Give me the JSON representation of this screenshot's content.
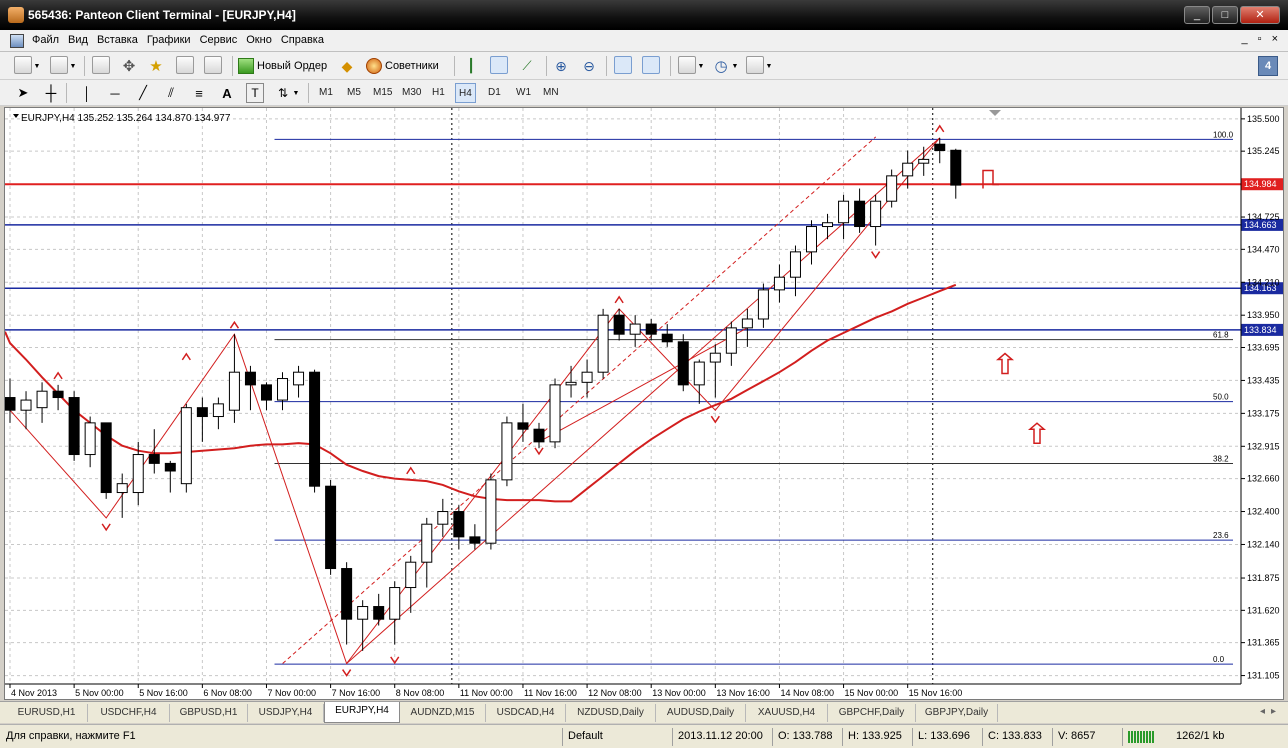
{
  "window": {
    "title": "565436: Panteon Client Terminal - [EURJPY,H4]",
    "buttons": [
      "_",
      "□",
      "✕"
    ]
  },
  "menu": {
    "items": [
      "Файл",
      "Вид",
      "Вставка",
      "Графики",
      "Сервис",
      "Окно",
      "Справка"
    ],
    "mdi_buttons": [
      "_",
      "▫",
      "×"
    ]
  },
  "toolbar": {
    "new_order_label": "Новый Ордер",
    "advisors_label": "Советники"
  },
  "timeframes": [
    "M1",
    "M5",
    "M15",
    "M30",
    "H1",
    "H4",
    "D1",
    "W1",
    "MN"
  ],
  "active_timeframe": "H4",
  "chart": {
    "header": "EURJPY,H4  135.252 135.264 134.870 134.977",
    "price_labels": [
      "135.500",
      "135.245",
      "134.725",
      "134.470",
      "134.210",
      "133.950",
      "133.695",
      "133.435",
      "133.175",
      "132.915",
      "132.660",
      "132.400",
      "132.140",
      "131.875",
      "131.620",
      "131.365",
      "131.105"
    ],
    "highlight_labels": [
      {
        "text": "134.984",
        "price": 134.984,
        "color": "#e02020"
      },
      {
        "text": "134.663",
        "price": 134.663,
        "color": "#1a2aa0"
      },
      {
        "text": "134.163",
        "price": 134.163,
        "color": "#1a2aa0"
      },
      {
        "text": "133.834",
        "price": 133.834,
        "color": "#1a2aa0"
      }
    ],
    "fib_levels": [
      {
        "label": "100.0",
        "price": 135.338
      },
      {
        "label": "61.8",
        "price": 133.757
      },
      {
        "label": "50.0",
        "price": 133.268
      },
      {
        "label": "38.2",
        "price": 132.779
      },
      {
        "label": "23.6",
        "price": 132.174
      },
      {
        "label": "0.0",
        "price": 131.195
      }
    ],
    "time_labels": [
      "4 Nov 2013",
      "5 Nov 00:00",
      "5 Nov 16:00",
      "6 Nov 08:00",
      "7 Nov 00:00",
      "7 Nov 16:00",
      "8 Nov 08:00",
      "11 Nov 00:00",
      "11 Nov 16:00",
      "12 Nov 08:00",
      "13 Nov 00:00",
      "13 Nov 16:00",
      "14 Nov 08:00",
      "15 Nov 00:00",
      "15 Nov 16:00"
    ]
  },
  "chart_data": {
    "type": "candlestick",
    "symbol": "EURJPY",
    "timeframe": "H4",
    "ylim": [
      131.07,
      135.57
    ],
    "grid": true,
    "candles": [
      {
        "o": 133.3,
        "h": 133.45,
        "l": 133.1,
        "c": 133.2
      },
      {
        "o": 133.2,
        "h": 133.35,
        "l": 133.05,
        "c": 133.28
      },
      {
        "o": 133.22,
        "h": 133.42,
        "l": 133.1,
        "c": 133.35
      },
      {
        "o": 133.35,
        "h": 133.4,
        "l": 133.2,
        "c": 133.3
      },
      {
        "o": 133.3,
        "h": 133.35,
        "l": 132.8,
        "c": 132.85
      },
      {
        "o": 132.85,
        "h": 133.15,
        "l": 132.75,
        "c": 133.1
      },
      {
        "o": 133.1,
        "h": 133.1,
        "l": 132.5,
        "c": 132.55
      },
      {
        "o": 132.55,
        "h": 132.7,
        "l": 132.35,
        "c": 132.62
      },
      {
        "o": 132.55,
        "h": 132.95,
        "l": 132.45,
        "c": 132.85
      },
      {
        "o": 132.85,
        "h": 133.05,
        "l": 132.7,
        "c": 132.78
      },
      {
        "o": 132.78,
        "h": 132.8,
        "l": 132.55,
        "c": 132.72
      },
      {
        "o": 132.62,
        "h": 133.25,
        "l": 132.55,
        "c": 133.22
      },
      {
        "o": 133.22,
        "h": 133.3,
        "l": 132.95,
        "c": 133.15
      },
      {
        "o": 133.15,
        "h": 133.3,
        "l": 133.05,
        "c": 133.25
      },
      {
        "o": 133.2,
        "h": 133.8,
        "l": 133.1,
        "c": 133.5
      },
      {
        "o": 133.5,
        "h": 133.55,
        "l": 133.2,
        "c": 133.4
      },
      {
        "o": 133.4,
        "h": 133.42,
        "l": 133.2,
        "c": 133.28
      },
      {
        "o": 133.28,
        "h": 133.5,
        "l": 133.2,
        "c": 133.45
      },
      {
        "o": 133.4,
        "h": 133.55,
        "l": 133.3,
        "c": 133.5
      },
      {
        "o": 133.5,
        "h": 133.52,
        "l": 132.55,
        "c": 132.6
      },
      {
        "o": 132.6,
        "h": 132.65,
        "l": 131.9,
        "c": 131.95
      },
      {
        "o": 131.95,
        "h": 132.0,
        "l": 131.35,
        "c": 131.55
      },
      {
        "o": 131.55,
        "h": 131.7,
        "l": 131.3,
        "c": 131.65
      },
      {
        "o": 131.65,
        "h": 131.75,
        "l": 131.5,
        "c": 131.55
      },
      {
        "o": 131.55,
        "h": 131.85,
        "l": 131.35,
        "c": 131.8
      },
      {
        "o": 131.8,
        "h": 132.05,
        "l": 131.6,
        "c": 132.0
      },
      {
        "o": 132.0,
        "h": 132.35,
        "l": 131.8,
        "c": 132.3
      },
      {
        "o": 132.3,
        "h": 132.5,
        "l": 132.2,
        "c": 132.4
      },
      {
        "o": 132.4,
        "h": 132.45,
        "l": 132.1,
        "c": 132.2
      },
      {
        "o": 132.2,
        "h": 132.3,
        "l": 132.1,
        "c": 132.15
      },
      {
        "o": 132.15,
        "h": 132.7,
        "l": 132.1,
        "c": 132.65
      },
      {
        "o": 132.65,
        "h": 133.15,
        "l": 132.6,
        "c": 133.1
      },
      {
        "o": 133.1,
        "h": 133.25,
        "l": 132.95,
        "c": 133.05
      },
      {
        "o": 133.05,
        "h": 133.1,
        "l": 132.9,
        "c": 132.95
      },
      {
        "o": 132.95,
        "h": 133.45,
        "l": 132.9,
        "c": 133.4
      },
      {
        "o": 133.4,
        "h": 133.55,
        "l": 133.3,
        "c": 133.42
      },
      {
        "o": 133.42,
        "h": 133.6,
        "l": 133.3,
        "c": 133.5
      },
      {
        "o": 133.5,
        "h": 134.0,
        "l": 133.45,
        "c": 133.95
      },
      {
        "o": 133.95,
        "h": 134.0,
        "l": 133.75,
        "c": 133.8
      },
      {
        "o": 133.8,
        "h": 133.95,
        "l": 133.7,
        "c": 133.88
      },
      {
        "o": 133.88,
        "h": 133.92,
        "l": 133.75,
        "c": 133.8
      },
      {
        "o": 133.8,
        "h": 133.88,
        "l": 133.7,
        "c": 133.74
      },
      {
        "o": 133.74,
        "h": 133.8,
        "l": 133.35,
        "c": 133.4
      },
      {
        "o": 133.4,
        "h": 133.6,
        "l": 133.25,
        "c": 133.58
      },
      {
        "o": 133.58,
        "h": 133.72,
        "l": 133.3,
        "c": 133.65
      },
      {
        "o": 133.65,
        "h": 133.9,
        "l": 133.55,
        "c": 133.85
      },
      {
        "o": 133.85,
        "h": 134.0,
        "l": 133.7,
        "c": 133.92
      },
      {
        "o": 133.92,
        "h": 134.2,
        "l": 133.85,
        "c": 134.15
      },
      {
        "o": 134.15,
        "h": 134.35,
        "l": 134.05,
        "c": 134.25
      },
      {
        "o": 134.25,
        "h": 134.5,
        "l": 134.1,
        "c": 134.45
      },
      {
        "o": 134.45,
        "h": 134.7,
        "l": 134.35,
        "c": 134.65
      },
      {
        "o": 134.65,
        "h": 134.75,
        "l": 134.55,
        "c": 134.68
      },
      {
        "o": 134.68,
        "h": 134.9,
        "l": 134.55,
        "c": 134.85
      },
      {
        "o": 134.85,
        "h": 134.95,
        "l": 134.6,
        "c": 134.65
      },
      {
        "o": 134.65,
        "h": 134.9,
        "l": 134.5,
        "c": 134.85
      },
      {
        "o": 134.85,
        "h": 135.1,
        "l": 134.8,
        "c": 135.05
      },
      {
        "o": 135.05,
        "h": 135.25,
        "l": 134.95,
        "c": 135.15
      },
      {
        "o": 135.15,
        "h": 135.28,
        "l": 135.05,
        "c": 135.18
      },
      {
        "o": 135.3,
        "h": 135.35,
        "l": 135.15,
        "c": 135.25
      },
      {
        "o": 135.252,
        "h": 135.264,
        "l": 134.87,
        "c": 134.977
      }
    ],
    "ma": [
      133.73,
      133.6,
      133.46,
      133.33,
      133.2,
      133.1,
      133.0,
      132.92,
      132.88,
      132.86,
      132.86,
      132.87,
      132.88,
      132.89,
      132.9,
      132.92,
      132.93,
      132.93,
      132.94,
      132.93,
      132.86,
      132.77,
      132.72,
      132.68,
      132.66,
      132.65,
      132.64,
      132.61,
      132.56,
      132.52,
      132.5,
      132.49,
      132.49,
      132.49,
      132.48,
      132.48,
      132.58,
      132.68,
      132.78,
      132.88,
      132.97,
      133.05,
      133.13,
      133.19,
      133.24,
      133.29,
      133.36,
      133.43,
      133.5,
      133.58,
      133.67,
      133.75,
      133.81,
      133.87,
      133.93,
      133.98,
      134.04,
      134.09,
      134.14,
      134.19
    ],
    "zigzag": [
      [
        0,
        133.2
      ],
      [
        6,
        132.35
      ],
      [
        14,
        133.8
      ],
      [
        21,
        131.2
      ],
      [
        38,
        134.0
      ],
      [
        44,
        133.2
      ],
      [
        58,
        135.35
      ]
    ],
    "fractals_up": [
      [
        3,
        133.4
      ],
      [
        11,
        133.55
      ],
      [
        14,
        133.8
      ],
      [
        25,
        132.65
      ],
      [
        38,
        134.0
      ],
      [
        58,
        135.35
      ]
    ],
    "fractals_down": [
      [
        6,
        132.35
      ],
      [
        21,
        131.2
      ],
      [
        24,
        131.3
      ],
      [
        33,
        132.95
      ],
      [
        44,
        133.2
      ],
      [
        54,
        134.5
      ]
    ],
    "signals_down": [
      {
        "price": 134.95,
        "x": 986
      }
    ],
    "signals_up": [
      {
        "price": 133.6,
        "x": 1000
      },
      {
        "price": 133.05,
        "x": 1032
      }
    ]
  },
  "tabs": [
    "EURUSD,H1",
    "USDCHF,H4",
    "GBPUSD,H1",
    "USDJPY,H4",
    "EURJPY,H4",
    "AUDNZD,M15",
    "USDCAD,H4",
    "NZDUSD,Daily",
    "AUDUSD,Daily",
    "XAUUSD,H4",
    "GBPCHF,Daily",
    "GBPJPY,Daily"
  ],
  "active_tab": "EURJPY,H4",
  "status": {
    "help": "Для справки, нажмите F1",
    "profile": "Default",
    "datetime": "2013.11.12 20:00",
    "open": "O: 133.788",
    "high": "H: 133.925",
    "low": "L: 133.696",
    "close": "C: 133.833",
    "volume": "V: 8657",
    "traffic": "1262/1 kb"
  },
  "colors": {
    "candle_up_fill": "#ffffff",
    "candle_down_fill": "#000000",
    "ma": "#d21e1e",
    "level_red": "#e02020",
    "level_blue": "#1a2aa0",
    "fib": "#1a2aa0"
  }
}
